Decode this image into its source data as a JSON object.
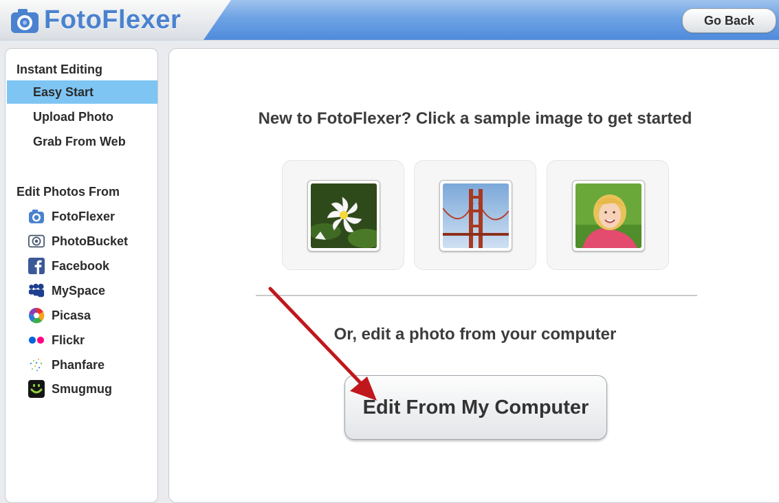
{
  "header": {
    "logo_text": "FotoFlexer",
    "go_back_label": "Go Back"
  },
  "sidebar": {
    "instant_heading": "Instant Editing",
    "instant_items": [
      {
        "label": "Easy Start",
        "active": true
      },
      {
        "label": "Upload Photo",
        "active": false
      },
      {
        "label": "Grab From Web",
        "active": false
      }
    ],
    "sources_heading": "Edit Photos From",
    "sources": [
      {
        "label": "FotoFlexer",
        "icon": "fotoflexer-icon"
      },
      {
        "label": "PhotoBucket",
        "icon": "photobucket-icon"
      },
      {
        "label": "Facebook",
        "icon": "facebook-icon"
      },
      {
        "label": "MySpace",
        "icon": "myspace-icon"
      },
      {
        "label": "Picasa",
        "icon": "picasa-icon"
      },
      {
        "label": "Flickr",
        "icon": "flickr-icon"
      },
      {
        "label": "Phanfare",
        "icon": "phanfare-icon"
      },
      {
        "label": "Smugmug",
        "icon": "smugmug-icon"
      }
    ]
  },
  "main": {
    "intro_text": "New to FotoFlexer? Click a sample image to get started",
    "samples": [
      "water-lily",
      "golden-gate-bridge",
      "smiling-girl"
    ],
    "or_text": "Or, edit a photo from your computer",
    "edit_button_label": "Edit From My Computer"
  },
  "colors": {
    "header_blue": "#5a93df",
    "active_item": "#7ec5f3",
    "arrow": "#c0171c"
  }
}
